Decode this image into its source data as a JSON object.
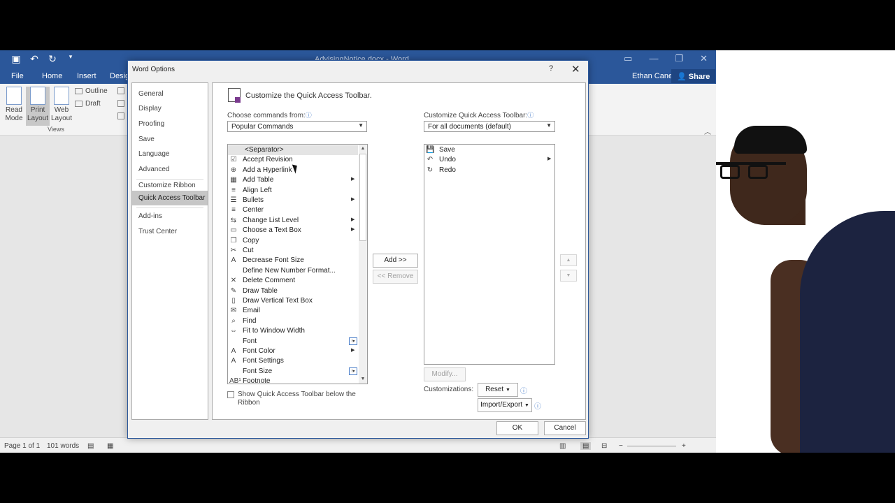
{
  "word": {
    "doc_title": "AdvisingNotice.docx - Word",
    "tabs": [
      "File",
      "Home",
      "Insert",
      "Desig"
    ],
    "user": "Ethan Cane",
    "share": "Share",
    "ribbon": {
      "read_mode": "Read Mode",
      "print_layout": "Print Layout",
      "web_layout": "Web Layout",
      "outline": "Outline",
      "draft": "Draft",
      "views_group": "Views"
    },
    "status": {
      "page": "Page 1 of 1",
      "words": "101 words"
    }
  },
  "dialog": {
    "title": "Word Options",
    "help": "?",
    "close": "✕",
    "nav": [
      {
        "label": "General"
      },
      {
        "label": "Display"
      },
      {
        "label": "Proofing"
      },
      {
        "label": "Save"
      },
      {
        "label": "Language"
      },
      {
        "label": "Advanced"
      },
      {
        "label": "Customize Ribbon"
      },
      {
        "label": "Quick Access Toolbar"
      },
      {
        "label": "Add-ins"
      },
      {
        "label": "Trust Center"
      }
    ],
    "selected_nav": "Quick Access Toolbar",
    "section_title": "Customize the Quick Access Toolbar.",
    "choose_from_label": "Choose commands from:",
    "choose_from_value": "Popular Commands",
    "customize_label": "Customize Quick Access Toolbar:",
    "customize_value": "For all documents (default)",
    "commands": [
      {
        "label": "<Separator>",
        "icon": "",
        "extra": "",
        "selected": true
      },
      {
        "label": "Accept Revision",
        "icon": "☑",
        "extra": ""
      },
      {
        "label": "Add a Hyperlink",
        "icon": "⊕",
        "extra": ""
      },
      {
        "label": "Add Table",
        "icon": "▦",
        "extra": "arrow"
      },
      {
        "label": "Align Left",
        "icon": "≡",
        "extra": ""
      },
      {
        "label": "Bullets",
        "icon": "☰",
        "extra": "arrow"
      },
      {
        "label": "Center",
        "icon": "≡",
        "extra": ""
      },
      {
        "label": "Change List Level",
        "icon": "⇆",
        "extra": "arrow"
      },
      {
        "label": "Choose a Text Box",
        "icon": "▭",
        "extra": "arrow"
      },
      {
        "label": "Copy",
        "icon": "❐",
        "extra": ""
      },
      {
        "label": "Cut",
        "icon": "✂",
        "extra": ""
      },
      {
        "label": "Decrease Font Size",
        "icon": "A",
        "extra": ""
      },
      {
        "label": "Define New Number Format...",
        "icon": "",
        "extra": ""
      },
      {
        "label": "Delete Comment",
        "icon": "✕",
        "extra": ""
      },
      {
        "label": "Draw Table",
        "icon": "✎",
        "extra": ""
      },
      {
        "label": "Draw Vertical Text Box",
        "icon": "▯",
        "extra": ""
      },
      {
        "label": "Email",
        "icon": "✉",
        "extra": ""
      },
      {
        "label": "Find",
        "icon": "⌕",
        "extra": ""
      },
      {
        "label": "Fit to Window Width",
        "icon": "⇔",
        "extra": ""
      },
      {
        "label": "Font",
        "icon": "",
        "extra": "combo"
      },
      {
        "label": "Font Color",
        "icon": "A",
        "extra": "arrow"
      },
      {
        "label": "Font Settings",
        "icon": "A",
        "extra": ""
      },
      {
        "label": "Font Size",
        "icon": "",
        "extra": "combo"
      },
      {
        "label": "Footnote",
        "icon": "AB¹",
        "extra": ""
      }
    ],
    "toolbar_items": [
      {
        "label": "Save",
        "icon": "💾",
        "extra": ""
      },
      {
        "label": "Undo",
        "icon": "↶",
        "extra": "arrow"
      },
      {
        "label": "Redo",
        "icon": "↻",
        "extra": ""
      }
    ],
    "add_button": "Add >>",
    "remove_button": "<< Remove",
    "modify_button": "Modify...",
    "customizations_label": "Customizations:",
    "reset_button": "Reset",
    "import_export_button": "Import/Export",
    "show_below_label": "Show Quick Access Toolbar below the Ribbon",
    "ok_button": "OK",
    "cancel_button": "Cancel"
  },
  "colors": {
    "word_blue": "#2b579a",
    "dialog_bg": "#f0f0f0"
  }
}
